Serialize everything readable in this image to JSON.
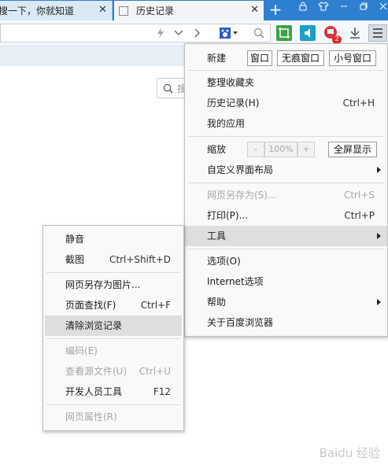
{
  "tabs": [
    {
      "label": "搜一下，你就知道",
      "close": "✕"
    },
    {
      "label": "历史记录",
      "close": "✕"
    }
  ],
  "new_tab": "+",
  "search_placeholder": "搜",
  "main_menu": {
    "items": [
      {
        "label": "新建",
        "buttons": [
          "窗口",
          "无痕窗口",
          "小号窗口"
        ]
      },
      {
        "label": "整理收藏夹"
      },
      {
        "label": "历史记录(H)",
        "shortcut": "Ctrl+H"
      },
      {
        "label": "我的应用"
      },
      {
        "label": "缩放",
        "zoom_minus": "-",
        "zoom_value": "100%",
        "zoom_plus": "+",
        "fullscreen": "全屏显示"
      },
      {
        "label": "自定义界面布局"
      },
      {
        "label": "网页另存为(S)...",
        "shortcut": "Ctrl+S"
      },
      {
        "label": "打印(P)...",
        "shortcut": "Ctrl+P"
      },
      {
        "label": "工具"
      },
      {
        "label": "选项(O)"
      },
      {
        "label": "Internet选项"
      },
      {
        "label": "帮助"
      },
      {
        "label": "关于百度浏览器"
      }
    ]
  },
  "tools_submenu": {
    "items": [
      {
        "label": "静音"
      },
      {
        "label": "截图",
        "shortcut": "Ctrl+Shift+D"
      },
      {
        "label": "网页另存为图片..."
      },
      {
        "label": "页面查找(F)",
        "shortcut": "Ctrl+F"
      },
      {
        "label": "清除浏览记录"
      },
      {
        "label": "编码(E)"
      },
      {
        "label": "查看源文件(U)",
        "shortcut": "Ctrl+U"
      },
      {
        "label": "开发人员工具",
        "shortcut": "F12"
      },
      {
        "label": "网页属性(R)"
      }
    ]
  },
  "badge_count": "2",
  "watermark": "Baidu 经验",
  "colors": {
    "tabbar": "#2f7fd0",
    "highlight": "#dedede",
    "green_icon": "#3aa24b",
    "teal_icon": "#1d9fc7"
  }
}
